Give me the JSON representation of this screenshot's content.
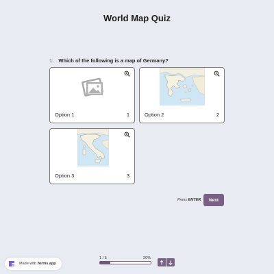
{
  "header": {
    "title": "World Map Quiz"
  },
  "question": {
    "number": "1.",
    "text": "Which of the following is a map of Germany?"
  },
  "options": [
    {
      "label": "Option 1",
      "key": "1",
      "image": "image-placeholder-icon"
    },
    {
      "label": "Option 2",
      "key": "2",
      "image": "greece-map"
    },
    {
      "label": "Option 3",
      "key": "3",
      "image": "italy-map"
    }
  ],
  "actions": {
    "press_hint": "Press",
    "press_key": "ENTER",
    "next_label": "Next"
  },
  "footer": {
    "made_with": "Made with",
    "brand": "forms.app",
    "progress_label": "1 / 5",
    "progress_percent": "20%",
    "progress_fraction": 0.2
  },
  "colors": {
    "accent": "#7b6085",
    "background": "#e9ebf2",
    "water": "#cfe6f5",
    "land": "#f1ecd9"
  }
}
